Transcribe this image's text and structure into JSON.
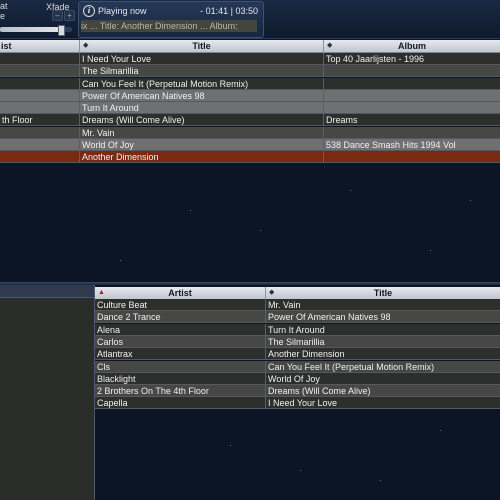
{
  "topbar": {
    "label_at": "at",
    "label_e": "e",
    "xfade_label": "Xfade",
    "minus_label": "–",
    "plus_label": "+",
    "crossfade_level": 0.85
  },
  "now_playing": {
    "icon": "info-icon",
    "label": "Playing now",
    "time": "- 01:41 | 03:50",
    "marquee": "ix ... Title: Another Dimension ... Album:"
  },
  "playlist": {
    "columns": [
      "ist",
      "Title",
      "Album"
    ],
    "rows": [
      {
        "artist": "",
        "title": "I Need Your Love",
        "album": "Top 40 Jaarlijsten - 1996",
        "style": "r-dark"
      },
      {
        "artist": "",
        "title": "The Silmarillia",
        "album": "",
        "style": "r-light"
      },
      {
        "artist": "",
        "title": "Can You Feel It (Perpetual Motion Remix)",
        "album": "",
        "style": "r-dark"
      },
      {
        "artist": "",
        "title": "Power Of American Natives 98",
        "album": "",
        "style": "r-gray"
      },
      {
        "artist": "",
        "title": "Turn It Around",
        "album": "",
        "style": "r-gray"
      },
      {
        "artist": "th Floor",
        "title": "Dreams (Will Come Alive)",
        "album": "Dreams",
        "style": "r-dark"
      },
      {
        "artist": "",
        "title": "Mr. Vain",
        "album": "",
        "style": "r-light"
      },
      {
        "artist": "",
        "title": "World Of Joy",
        "album": "538 Dance Smash Hits 1994 Vol",
        "style": "r-gray"
      },
      {
        "artist": "",
        "title": "Another Dimension",
        "album": "",
        "style": "r-sel"
      }
    ]
  },
  "library": {
    "columns": [
      "Artist",
      "Title"
    ],
    "rows": [
      {
        "artist": "Culture Beat",
        "title": "Mr. Vain",
        "style": "r-dark"
      },
      {
        "artist": "Dance 2 Trance",
        "title": "Power Of American Natives 98",
        "style": "r-light"
      },
      {
        "artist": "Alena",
        "title": "Turn It Around",
        "style": "r-dark"
      },
      {
        "artist": "Carlos",
        "title": "The Silmarillia",
        "style": "r-light"
      },
      {
        "artist": "Atlantrax",
        "title": "Another Dimension",
        "style": "r-dark"
      },
      {
        "artist": "Cls",
        "title": "Can You Feel It (Perpetual Motion Remix)",
        "style": "r-light"
      },
      {
        "artist": "Blacklight",
        "title": "World Of Joy",
        "style": "r-dark"
      },
      {
        "artist": "2 Brothers On The 4th Floor",
        "title": "Dreams (Will Come Alive)",
        "style": "r-light"
      },
      {
        "artist": "Capella",
        "title": "I Need Your Love",
        "style": "r-dark"
      }
    ]
  },
  "colors": {
    "background": "#0b1526",
    "selected_row": "#7a2a10",
    "header": "#c0c6cf"
  }
}
